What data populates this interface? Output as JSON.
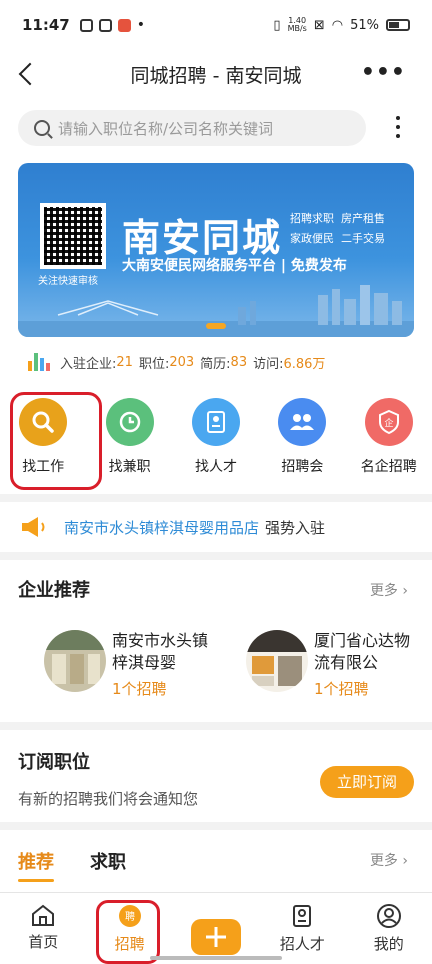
{
  "status_bar": {
    "time": "11:47",
    "net_speed_value": "1.40",
    "net_speed_unit": "MB/s",
    "battery": "51%"
  },
  "header": {
    "title": "同城招聘 - 南安同城",
    "more": "•••"
  },
  "search": {
    "placeholder": "请输入职位名称/公司名称关键词"
  },
  "banner": {
    "qr_caption": "关注快速审核",
    "title": "南安同城",
    "tags": [
      "招聘求职",
      "房产租售",
      "家政便民",
      "二手交易"
    ],
    "subtitle": "大南安便民网络服务平台 | 免费发布"
  },
  "stats": {
    "companies_label": "入驻企业:",
    "companies_value": "21",
    "jobs_label": "职位:",
    "jobs_value": "203",
    "resumes_label": "简历:",
    "resumes_value": "83",
    "visits_label": "访问:",
    "visits_value": "6.86万"
  },
  "menu": {
    "items": [
      {
        "label": "找工作",
        "icon": "search-icon",
        "color": "#e8a21b"
      },
      {
        "label": "找兼职",
        "icon": "clock-icon",
        "color": "#5bc07c"
      },
      {
        "label": "找人才",
        "icon": "resume-icon",
        "color": "#4aa7f0"
      },
      {
        "label": "招聘会",
        "icon": "people-icon",
        "color": "#4a8cf0"
      },
      {
        "label": "名企招聘",
        "icon": "shield-icon",
        "color": "#f06a66"
      }
    ]
  },
  "notice": {
    "shop": "南安市水头镇梓淇母婴用品店",
    "tail": "强势入驻"
  },
  "companies": {
    "title": "企业推荐",
    "more": "更多",
    "items": [
      {
        "name": "南安市水头镇梓淇母婴",
        "count": "1个招聘"
      },
      {
        "name": "厦门省心达物流有限公",
        "count": "1个招聘"
      }
    ]
  },
  "subscribe": {
    "title": "订阅职位",
    "desc": "有新的招聘我们将会通知您",
    "button": "立即订阅"
  },
  "tabs": {
    "items": [
      "推荐",
      "求职"
    ],
    "more": "更多"
  },
  "bottom_nav": {
    "items": [
      {
        "label": "首页",
        "icon": "home-icon"
      },
      {
        "label": "招聘",
        "icon": "recruit-icon"
      },
      {
        "label": "",
        "icon": "plus-icon"
      },
      {
        "label": "招人才",
        "icon": "talent-icon"
      },
      {
        "label": "我的",
        "icon": "profile-icon"
      }
    ]
  },
  "colors": {
    "accent": "#f5a01a",
    "highlight_box": "#d91e2a",
    "link_blue": "#2e8bd6"
  }
}
